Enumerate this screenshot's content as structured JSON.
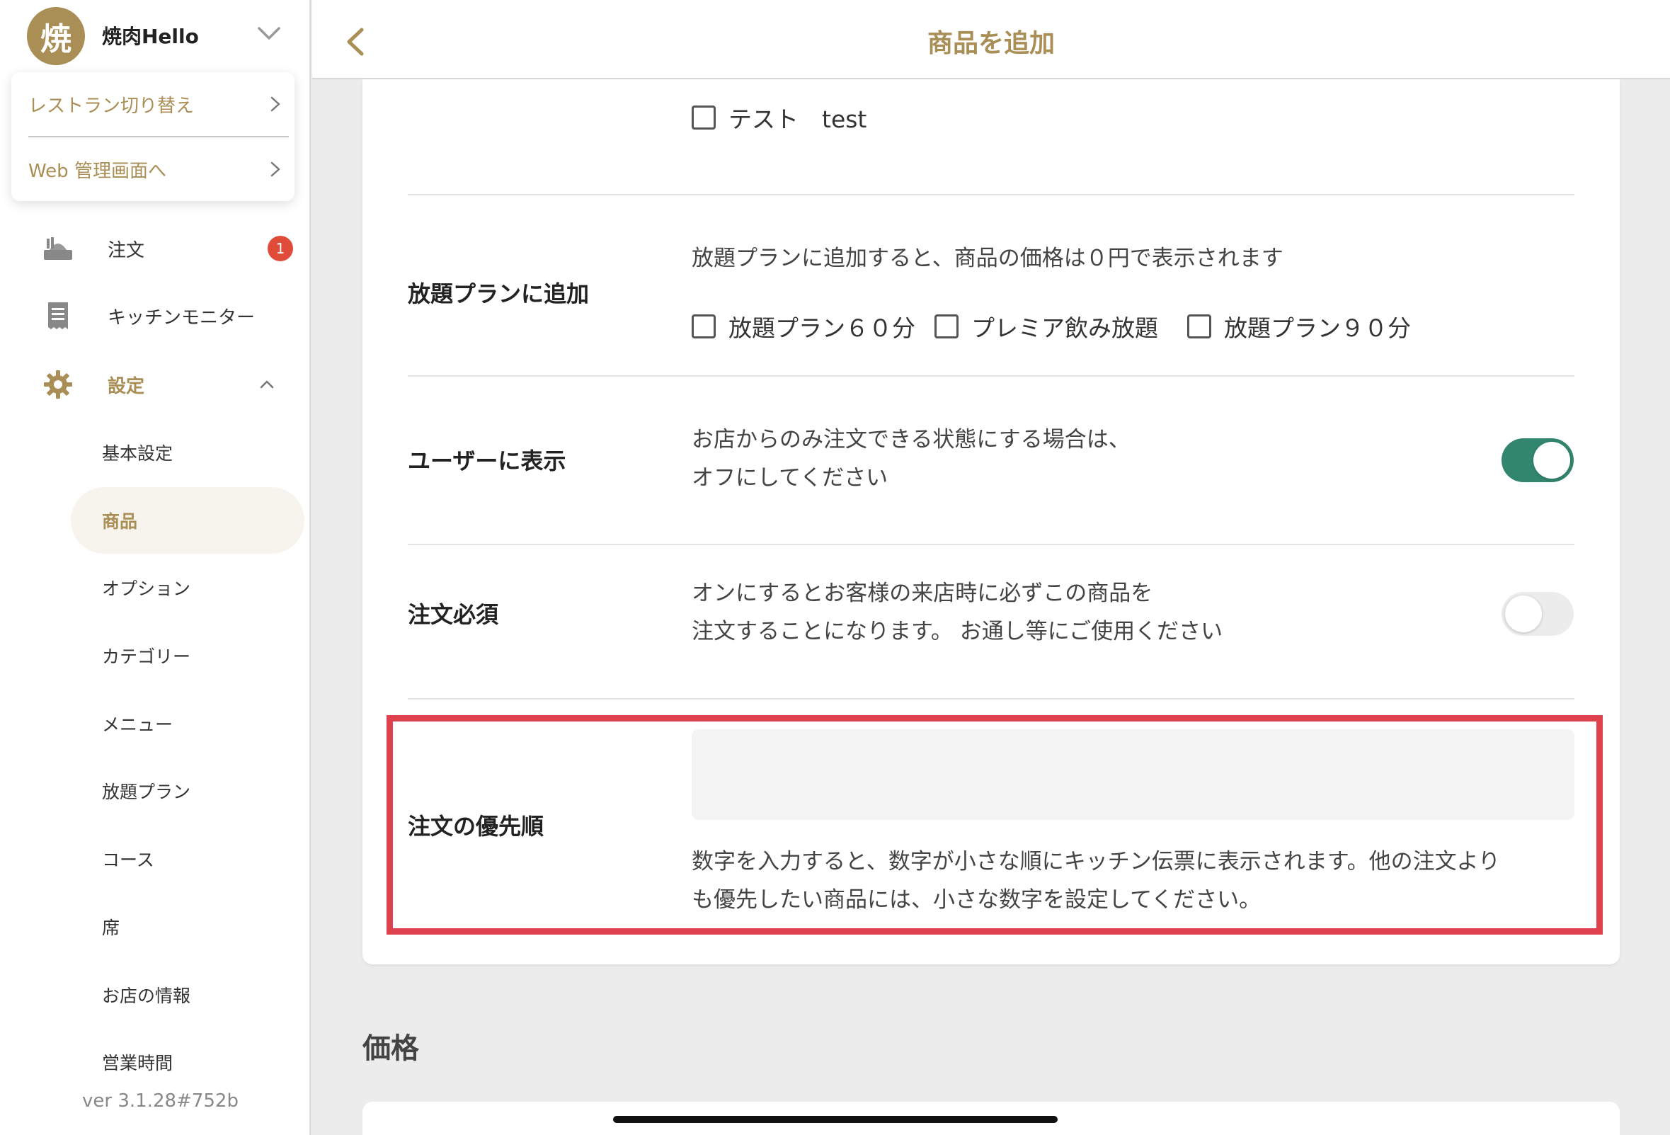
{
  "app": {
    "logo_char": "焼",
    "restaurant_name": "焼肉Hello",
    "version": "ver 3.1.28#752b",
    "accent_color": "#a98e55",
    "toggle_on_color": "#33866e",
    "highlight_color": "#e0414f"
  },
  "dropdown": {
    "items": [
      {
        "label": "レストラン切り替え",
        "icon": "chevron-right-icon"
      },
      {
        "label": "Web 管理画面へ",
        "icon": "chevron-right-icon"
      }
    ]
  },
  "nav": {
    "orders": {
      "label": "注文",
      "icon": "order-tray-icon",
      "badge": "1"
    },
    "kitchen": {
      "label": "キッチンモニター",
      "icon": "receipt-icon"
    },
    "settings": {
      "label": "設定",
      "icon": "gear-icon",
      "expanded": true
    }
  },
  "settings_menu": [
    {
      "label": "基本設定",
      "active": false
    },
    {
      "label": "商品",
      "active": true
    },
    {
      "label": "オプション",
      "active": false
    },
    {
      "label": "カテゴリー",
      "active": false
    },
    {
      "label": "メニュー",
      "active": false
    },
    {
      "label": "放題プラン",
      "active": false
    },
    {
      "label": "コース",
      "active": false
    },
    {
      "label": "席",
      "active": false
    },
    {
      "label": "お店の情報",
      "active": false
    },
    {
      "label": "営業時間",
      "active": false
    }
  ],
  "topbar": {
    "title": "商品を追加",
    "back_icon": "chevron-left-icon"
  },
  "form": {
    "test_checkbox": {
      "label": "テスト　test",
      "checked": false
    },
    "plan": {
      "label": "放題プランに追加",
      "description": "放題プランに追加すると、商品の価格は０円で表示されます",
      "options": [
        {
          "label": "放題プラン６０分",
          "checked": false
        },
        {
          "label": "プレミア飲み放題",
          "checked": false
        },
        {
          "label": "放題プラン９０分",
          "checked": false
        }
      ]
    },
    "visible": {
      "label": "ユーザーに表示",
      "description_line1": "お店からのみ注文できる状態にする場合は、",
      "description_line2": "オフにしてください",
      "value": true
    },
    "required": {
      "label": "注文必須",
      "description_line1": "オンにするとお客様の来店時に必ずこの商品を",
      "description_line2": "注文することになります。 お通し等にご使用ください",
      "value": false
    },
    "priority": {
      "label": "注文の優先順",
      "value": "",
      "placeholder": "",
      "help_line1": "数字を入力すると、数字が小さな順にキッチン伝票に表示されます。他の注文より",
      "help_line2": "も優先したい商品には、小さな数字を設定してください。"
    }
  },
  "price_section": {
    "heading": "価格"
  }
}
